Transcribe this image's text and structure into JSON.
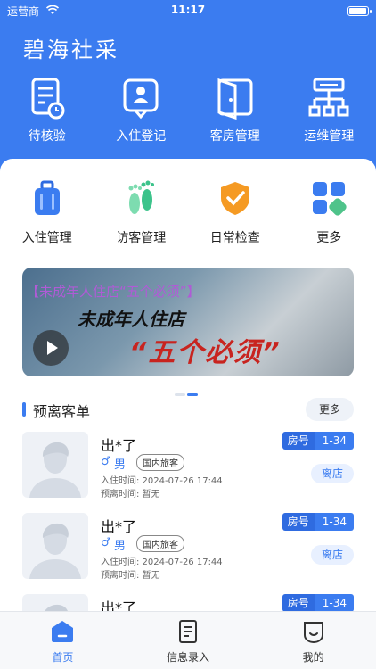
{
  "status_bar": {
    "carrier": "运营商",
    "time": "11:17"
  },
  "app_title": "碧海社采",
  "quick_actions": [
    {
      "label": "待核验",
      "icon": "document-clock-icon"
    },
    {
      "label": "入住登记",
      "icon": "id-card-icon"
    },
    {
      "label": "客房管理",
      "icon": "door-icon"
    },
    {
      "label": "运维管理",
      "icon": "network-icon"
    }
  ],
  "menu": [
    {
      "label": "入住管理",
      "icon": "luggage-icon"
    },
    {
      "label": "访客管理",
      "icon": "footprint-icon"
    },
    {
      "label": "日常检查",
      "icon": "shield-check-icon"
    },
    {
      "label": "更多",
      "icon": "grid-icon"
    }
  ],
  "banner": {
    "headline": "【未成年人住店“五个必须”】",
    "big_line1": "未成年人住店",
    "big_line2": "“五个必须”"
  },
  "section": {
    "title": "预离客单",
    "more_label": "更多"
  },
  "guests": [
    {
      "name": "出*了",
      "gender_icon": "♂",
      "gender": "男",
      "tag": "国内旅客",
      "checkin": "入住时间: 2024-07-26 17:44",
      "checkout": "预离时间: 暂无",
      "room_label": "房号",
      "room": "1-34",
      "action": "离店"
    },
    {
      "name": "出*了",
      "gender_icon": "♂",
      "gender": "男",
      "tag": "国内旅客",
      "checkin": "入住时间: 2024-07-26 17:44",
      "checkout": "预离时间: 暂无",
      "room_label": "房号",
      "room": "1-34",
      "action": "离店"
    },
    {
      "name": "出*了",
      "room_label": "房号",
      "room": "1-34"
    }
  ],
  "tabbar": [
    {
      "label": "首页",
      "icon": "home-icon",
      "active": true
    },
    {
      "label": "信息录入",
      "icon": "form-icon",
      "active": false
    },
    {
      "label": "我的",
      "icon": "profile-icon",
      "active": false
    }
  ],
  "colors": {
    "primary": "#3b7cf0",
    "background": "#f4f6fa"
  }
}
